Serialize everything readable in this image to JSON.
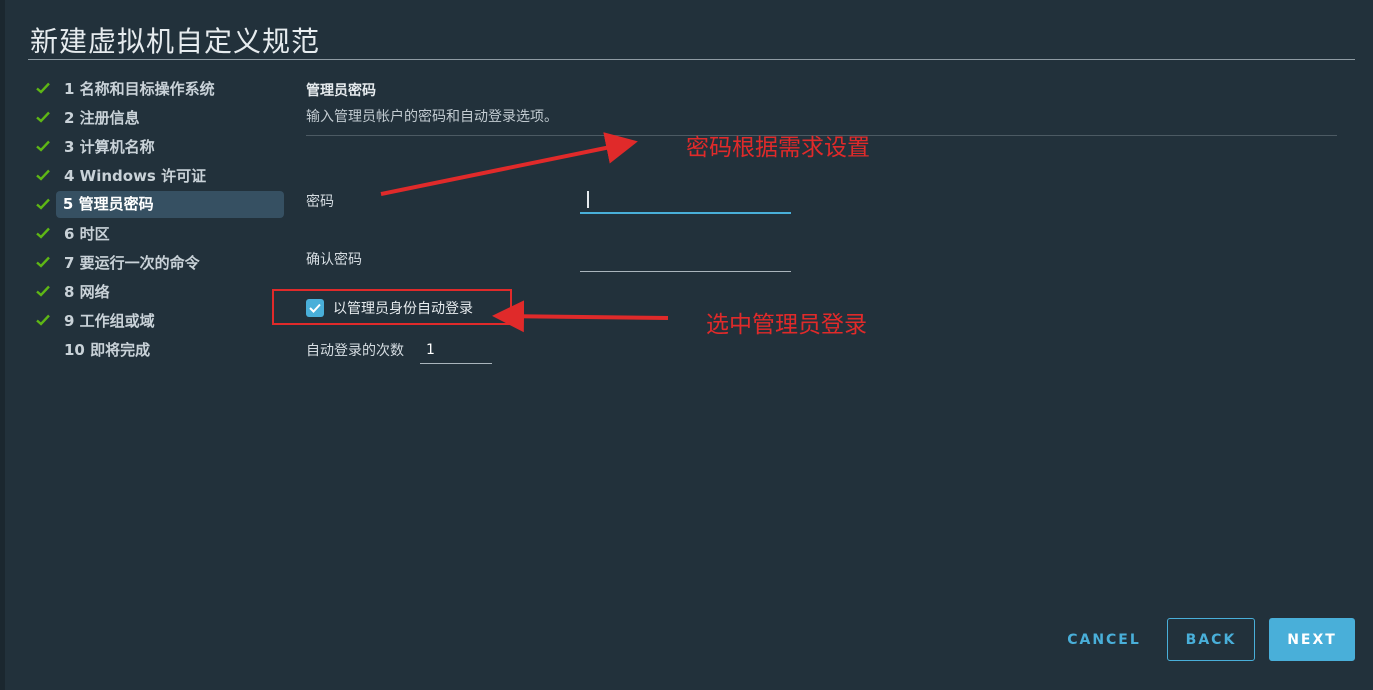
{
  "window": {
    "title": "新建虚拟机自定义规范"
  },
  "steps": [
    {
      "label": "1 名称和目标操作系统",
      "completed": true
    },
    {
      "label": "2 注册信息",
      "completed": true
    },
    {
      "label": "3 计算机名称",
      "completed": true
    },
    {
      "label": "4 Windows 许可证",
      "completed": true
    },
    {
      "label": "5 管理员密码",
      "completed": true,
      "active": true
    },
    {
      "label": "6 时区",
      "completed": true
    },
    {
      "label": "7 要运行一次的命令",
      "completed": true
    },
    {
      "label": "8 网络",
      "completed": true
    },
    {
      "label": "9 工作组或域",
      "completed": true
    },
    {
      "label": "10 即将完成",
      "completed": false
    }
  ],
  "section": {
    "title": "管理员密码",
    "description": "输入管理员帐户的密码和自动登录选项。"
  },
  "form": {
    "password_label": "密码",
    "password_value": "",
    "confirm_label": "确认密码",
    "confirm_value": "",
    "autologon_checked": true,
    "autologon_label": "以管理员身份自动登录",
    "logon_count_label": "自动登录的次数",
    "logon_count_value": "1"
  },
  "annotations": {
    "password_note": "密码根据需求设置",
    "checkbox_note": "选中管理员登录"
  },
  "buttons": {
    "cancel": "CANCEL",
    "back": "BACK",
    "next": "NEXT"
  },
  "colors": {
    "background": "#22313b",
    "accent": "#49afd9",
    "check_green": "#5eb715",
    "annotation_red": "#e02a2a",
    "active_step": "#365062"
  }
}
